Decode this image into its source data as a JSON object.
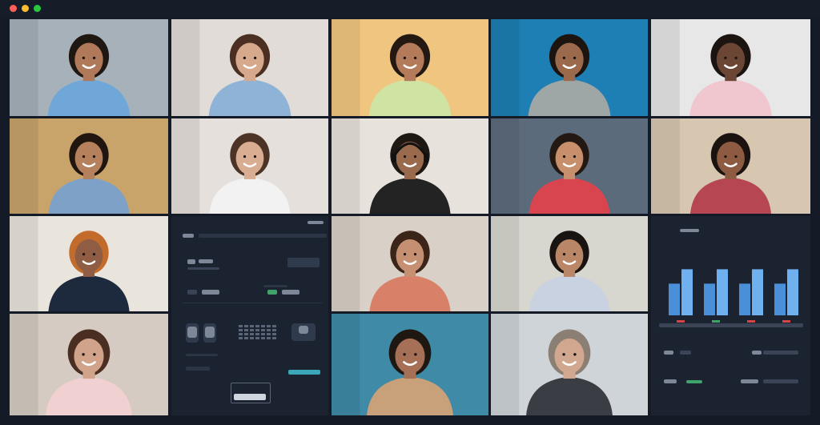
{
  "window": {
    "controls": [
      {
        "name": "close-dot",
        "color": "#ff5f57"
      },
      {
        "name": "minimize-dot",
        "color": "#febc2e"
      },
      {
        "name": "maximize-dot",
        "color": "#28c840"
      }
    ]
  },
  "participants": [
    {
      "id": "p1",
      "bg": "#a7b1ba",
      "skin": "#b07a5a",
      "hair": "#1f1712",
      "shirt": "#6ea7d8"
    },
    {
      "id": "p2",
      "bg": "#e2dcd8",
      "skin": "#d6a88c",
      "hair": "#4a2f22",
      "shirt": "#8fb3d6"
    },
    {
      "id": "p3",
      "bg": "#f0c57f",
      "skin": "#b37b59",
      "hair": "#241812",
      "shirt": "#cfe3a3"
    },
    {
      "id": "p4",
      "bg": "#1d7fb3",
      "skin": "#9b6a4c",
      "hair": "#1b140f",
      "shirt": "#9fa6a6"
    },
    {
      "id": "p5",
      "bg": "#e7e7e7",
      "skin": "#6c4634",
      "hair": "#1b1411",
      "shirt": "#f0c7cf"
    },
    {
      "id": "p6",
      "bg": "#c8a36a",
      "skin": "#b5805c",
      "hair": "#21160f",
      "shirt": "#7ea2c7"
    },
    {
      "id": "p7",
      "bg": "#e5e0db",
      "skin": "#d9ad91",
      "hair": "#4b3326",
      "shirt": "#f2f2f2"
    },
    {
      "id": "p8",
      "bg": "#e8e2dc",
      "skin": "#9a6a4c",
      "hair": "#1f1712",
      "shirt": "#232323",
      "headset": true
    },
    {
      "id": "p9",
      "bg": "#5c6b7b",
      "skin": "#c78f6b",
      "hair": "#241812",
      "shirt": "#d8454f"
    },
    {
      "id": "p10",
      "bg": "#d7c7b0",
      "skin": "#8d5b41",
      "hair": "#1a1310",
      "shirt": "#b64652"
    },
    {
      "id": "p11",
      "bg": "#e9e4dc",
      "skin": "#8f5d44",
      "hair": "#c36b2b",
      "shirt": "#1d2a3e"
    },
    {
      "id": "p12",
      "bg": "#d9d1c7",
      "skin": "#c58f72",
      "hair": "#3b2418",
      "shirt": "#d98068"
    },
    {
      "id": "p13",
      "bg": "#d7d7d0",
      "skin": "#b98667",
      "hair": "#191411",
      "shirt": "#c9d2e1"
    },
    {
      "id": "p14",
      "bg": "#d5cbc2",
      "skin": "#d0a38a",
      "hair": "#4a2e22",
      "shirt": "#f0d0d0"
    },
    {
      "id": "p15",
      "bg": "#3f8aa6",
      "skin": "#a57056",
      "hair": "#1f1712",
      "shirt": "#c8a07a"
    },
    {
      "id": "p16",
      "bg": "#cfd4d8",
      "skin": "#d1a78f",
      "hair": "#8b7e73",
      "shirt": "#3b3d44"
    }
  ],
  "shared_screen_1": {
    "theme": "dark"
  },
  "shared_screen_2": {
    "theme": "dark"
  },
  "chart_panel": {
    "bar_color": "#4a90d9",
    "bar_color_light": "#6fb0ee",
    "groups": [
      {
        "values": [
          0.55,
          0.8
        ],
        "marker_color": "#d64545"
      },
      {
        "values": [
          0.55,
          0.8
        ],
        "marker_color": "#3fa36a"
      },
      {
        "values": [
          0.55,
          0.8
        ],
        "marker_color": "#d64545"
      },
      {
        "values": [
          0.55,
          0.8
        ],
        "marker_color": "#d64545"
      }
    ]
  }
}
